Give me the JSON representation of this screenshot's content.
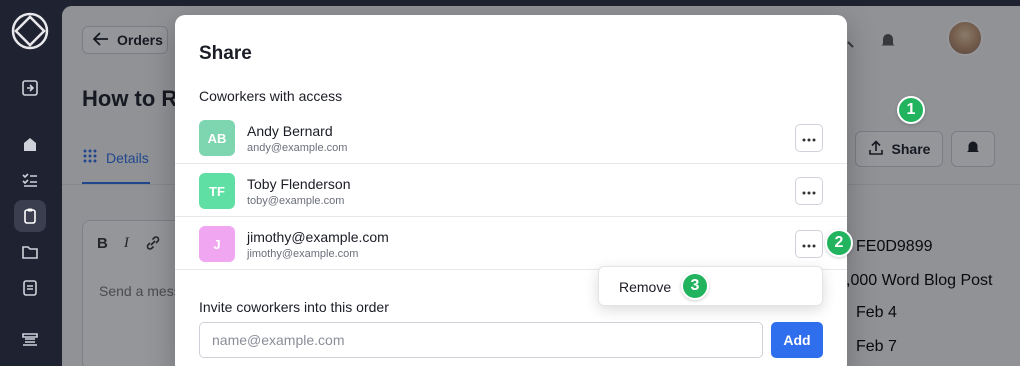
{
  "app": {
    "back_label": "Orders",
    "page_title": "How to R",
    "tab_details": "Details",
    "editor_placeholder": "Send a mess",
    "share_label": "Share",
    "right_panel": {
      "order_id": "FE0D9899",
      "service": ",000 Word Blog Post",
      "date_1": "Feb 4",
      "date_2": "Feb 7"
    }
  },
  "modal": {
    "title": "Share",
    "coworkers_label": "Coworkers with access",
    "people": [
      {
        "initials": "AB",
        "name": "Andy Bernard",
        "email": "andy@example.com",
        "color": "#7ed6b0"
      },
      {
        "initials": "TF",
        "name": "Toby Flenderson",
        "email": "toby@example.com",
        "color": "#5fdfa3"
      },
      {
        "initials": "J",
        "name": "jimothy@example.com",
        "email": "jimothy@example.com",
        "color": "#f0a6f0"
      }
    ],
    "invite_label": "Invite coworkers into this order",
    "invite_placeholder": "name@example.com",
    "add_label": "Add"
  },
  "dropdown": {
    "remove_label": "Remove"
  },
  "steps": [
    "1",
    "2",
    "3"
  ],
  "colors": {
    "accent": "#2f6fed",
    "step_badge": "#22b35e",
    "sidebar": "#1f2230"
  }
}
